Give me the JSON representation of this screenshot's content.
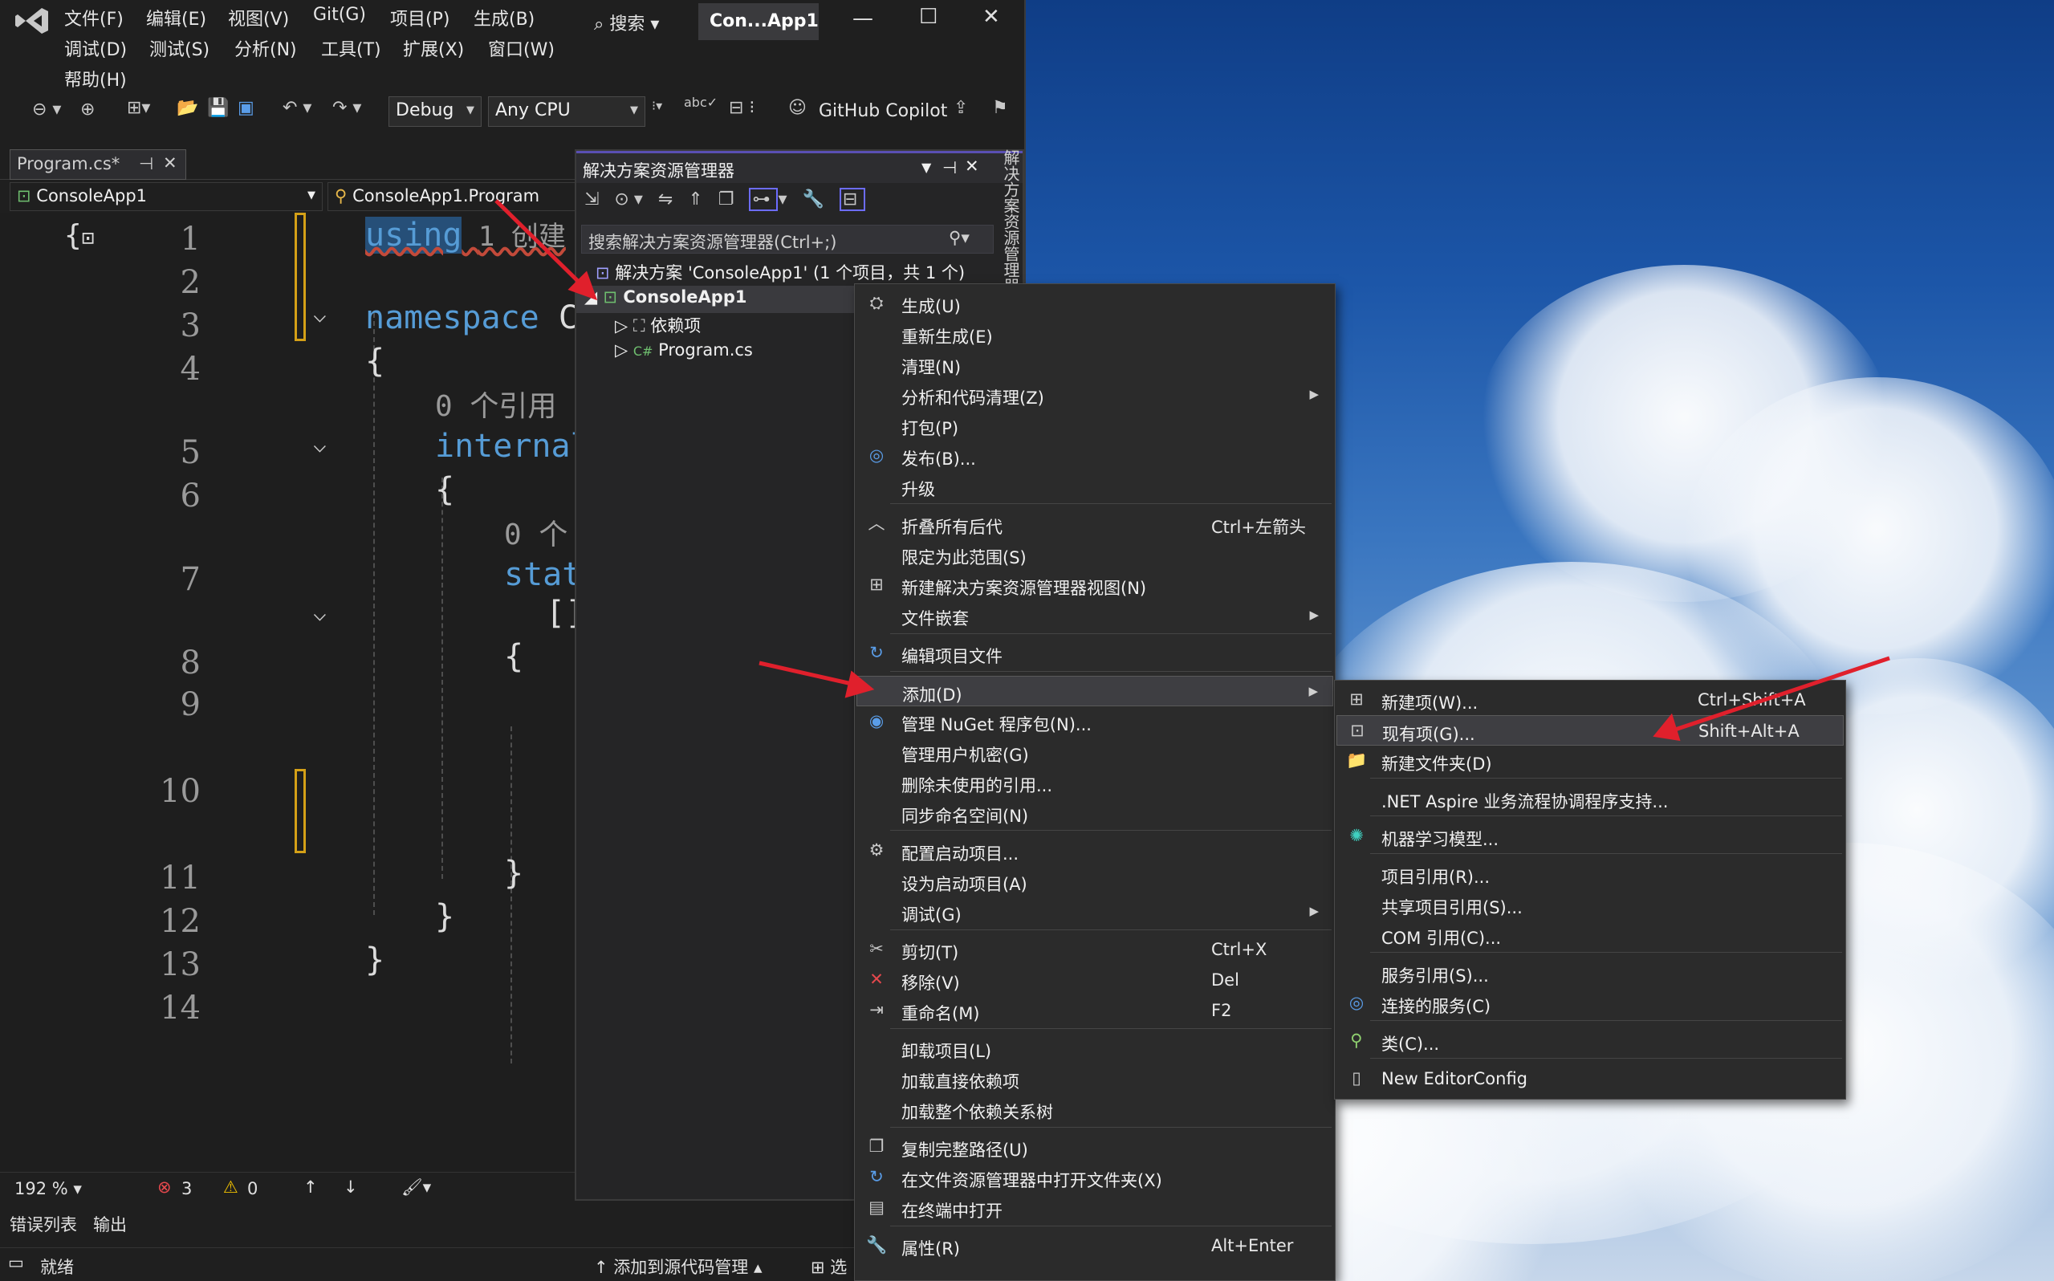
{
  "window": {
    "project_title": "Con...App1",
    "search_label": "搜索",
    "menus": [
      "文件(F)",
      "编辑(E)",
      "视图(V)",
      "Git(G)",
      "项目(P)",
      "生成(B)",
      "调试(D)",
      "测试(S)",
      "分析(N)",
      "工具(T)",
      "扩展(X)",
      "窗口(W)",
      "帮助(H)"
    ]
  },
  "toolbar": {
    "config": "Debug",
    "platform": "Any CPU",
    "copilot": "GitHub Copilot"
  },
  "editor": {
    "tab_title": "Program.cs*",
    "nav_project": "ConsoleApp1",
    "nav_class": "ConsoleApp1.Program",
    "line_numbers": [
      "1",
      "2",
      "3",
      "4",
      "5",
      "6",
      "7",
      "8",
      "9",
      "10",
      "11",
      "12",
      "13",
      "14"
    ],
    "code_using": "using",
    "code_using_hint": "1 创建",
    "code_namespace_kw": "namespace",
    "code_namespace_name": "Co",
    "code_open_brace": "{",
    "code_close_brace": "}",
    "code_refs_hint": "0 个引用",
    "code_internal": "internal",
    "code_refs_hint2": "0 个",
    "code_static": "stat",
    "code_bracket": "[]"
  },
  "solution_explorer": {
    "title": "解决方案资源管理器",
    "side_tab": "解决方案资源管理器",
    "search_placeholder": "搜索解决方案资源管理器(Ctrl+;)",
    "solution_node": "解决方案 'ConsoleApp1' (1 个项目，共 1 个)",
    "project_node": "ConsoleApp1",
    "deps_node": "依赖项",
    "program_node": "Program.cs",
    "cs_tag": "C#"
  },
  "context_menu": {
    "items": [
      {
        "label": "生成(U)",
        "shortcut": "",
        "icon": "build-icon"
      },
      {
        "label": "重新生成(E)",
        "shortcut": "",
        "icon": ""
      },
      {
        "label": "清理(N)",
        "shortcut": "",
        "icon": ""
      },
      {
        "label": "分析和代码清理(Z)",
        "shortcut": "",
        "icon": "",
        "submenu": true
      },
      {
        "label": "打包(P)",
        "shortcut": "",
        "icon": ""
      },
      {
        "label": "发布(B)...",
        "shortcut": "",
        "icon": "globe-icon"
      },
      {
        "label": "升级",
        "shortcut": "",
        "icon": ""
      },
      {
        "label": "折叠所有后代",
        "shortcut": "Ctrl+左箭头",
        "icon": "collapse-icon"
      },
      {
        "label": "限定为此范围(S)",
        "shortcut": "",
        "icon": ""
      },
      {
        "label": "新建解决方案资源管理器视图(N)",
        "shortcut": "",
        "icon": "new-view-icon"
      },
      {
        "label": "文件嵌套",
        "shortcut": "",
        "icon": "",
        "submenu": true
      },
      {
        "label": "编辑项目文件",
        "shortcut": "",
        "icon": "edit-project-icon"
      },
      {
        "label": "添加(D)",
        "shortcut": "",
        "icon": "",
        "submenu": true
      },
      {
        "label": "管理 NuGet 程序包(N)...",
        "shortcut": "",
        "icon": "nuget-icon"
      },
      {
        "label": "管理用户机密(G)",
        "shortcut": "",
        "icon": ""
      },
      {
        "label": "删除未使用的引用...",
        "shortcut": "",
        "icon": ""
      },
      {
        "label": "同步命名空间(N)",
        "shortcut": "",
        "icon": ""
      },
      {
        "label": "配置启动项目...",
        "shortcut": "",
        "icon": "gear-icon"
      },
      {
        "label": "设为启动项目(A)",
        "shortcut": "",
        "icon": ""
      },
      {
        "label": "调试(G)",
        "shortcut": "",
        "icon": "",
        "submenu": true
      },
      {
        "label": "剪切(T)",
        "shortcut": "Ctrl+X",
        "icon": "cut-icon"
      },
      {
        "label": "移除(V)",
        "shortcut": "Del",
        "icon": "remove-icon"
      },
      {
        "label": "重命名(M)",
        "shortcut": "F2",
        "icon": "rename-icon"
      },
      {
        "label": "卸载项目(L)",
        "shortcut": "",
        "icon": ""
      },
      {
        "label": "加载直接依赖项",
        "shortcut": "",
        "icon": ""
      },
      {
        "label": "加载整个依赖关系树",
        "shortcut": "",
        "icon": ""
      },
      {
        "label": "复制完整路径(U)",
        "shortcut": "",
        "icon": "copy-icon"
      },
      {
        "label": "在文件资源管理器中打开文件夹(X)",
        "shortcut": "",
        "icon": "open-folder-icon"
      },
      {
        "label": "在终端中打开",
        "shortcut": "",
        "icon": "terminal-icon"
      },
      {
        "label": "属性(R)",
        "shortcut": "Alt+Enter",
        "icon": "wrench-icon"
      }
    ]
  },
  "add_submenu": {
    "items": [
      {
        "label": "新建项(W)...",
        "shortcut": "Ctrl+Shift+A",
        "icon": "new-item-icon"
      },
      {
        "label": "现有项(G)...",
        "shortcut": "Shift+Alt+A",
        "icon": "existing-item-icon"
      },
      {
        "label": "新建文件夹(D)",
        "shortcut": "",
        "icon": "folder-icon"
      },
      {
        "label": ".NET Aspire 业务流程协调程序支持...",
        "shortcut": "",
        "icon": ""
      },
      {
        "label": "机器学习模型...",
        "shortcut": "",
        "icon": "ml-icon"
      },
      {
        "label": "项目引用(R)...",
        "shortcut": "",
        "icon": ""
      },
      {
        "label": "共享项目引用(S)...",
        "shortcut": "",
        "icon": ""
      },
      {
        "label": "COM 引用(C)...",
        "shortcut": "",
        "icon": ""
      },
      {
        "label": "服务引用(S)...",
        "shortcut": "",
        "icon": ""
      },
      {
        "label": "连接的服务(C)",
        "shortcut": "",
        "icon": "connected-service-icon"
      },
      {
        "label": "类(C)...",
        "shortcut": "",
        "icon": "class-icon"
      },
      {
        "label": "New EditorConfig",
        "shortcut": "",
        "icon": "file-icon"
      }
    ]
  },
  "statusbar": {
    "zoom": "192 %",
    "errors": "3",
    "warnings": "0",
    "bottom_tab_errors": "错误列表",
    "bottom_tab_output": "输出",
    "ready": "就绪",
    "source_control": "添加到源代码管理",
    "repo_partial": "选"
  },
  "colors": {
    "keyword": "#569cd6",
    "accent": "#5a4fb3",
    "arrow": "#e0202c",
    "change_marker": "#d4a017"
  }
}
